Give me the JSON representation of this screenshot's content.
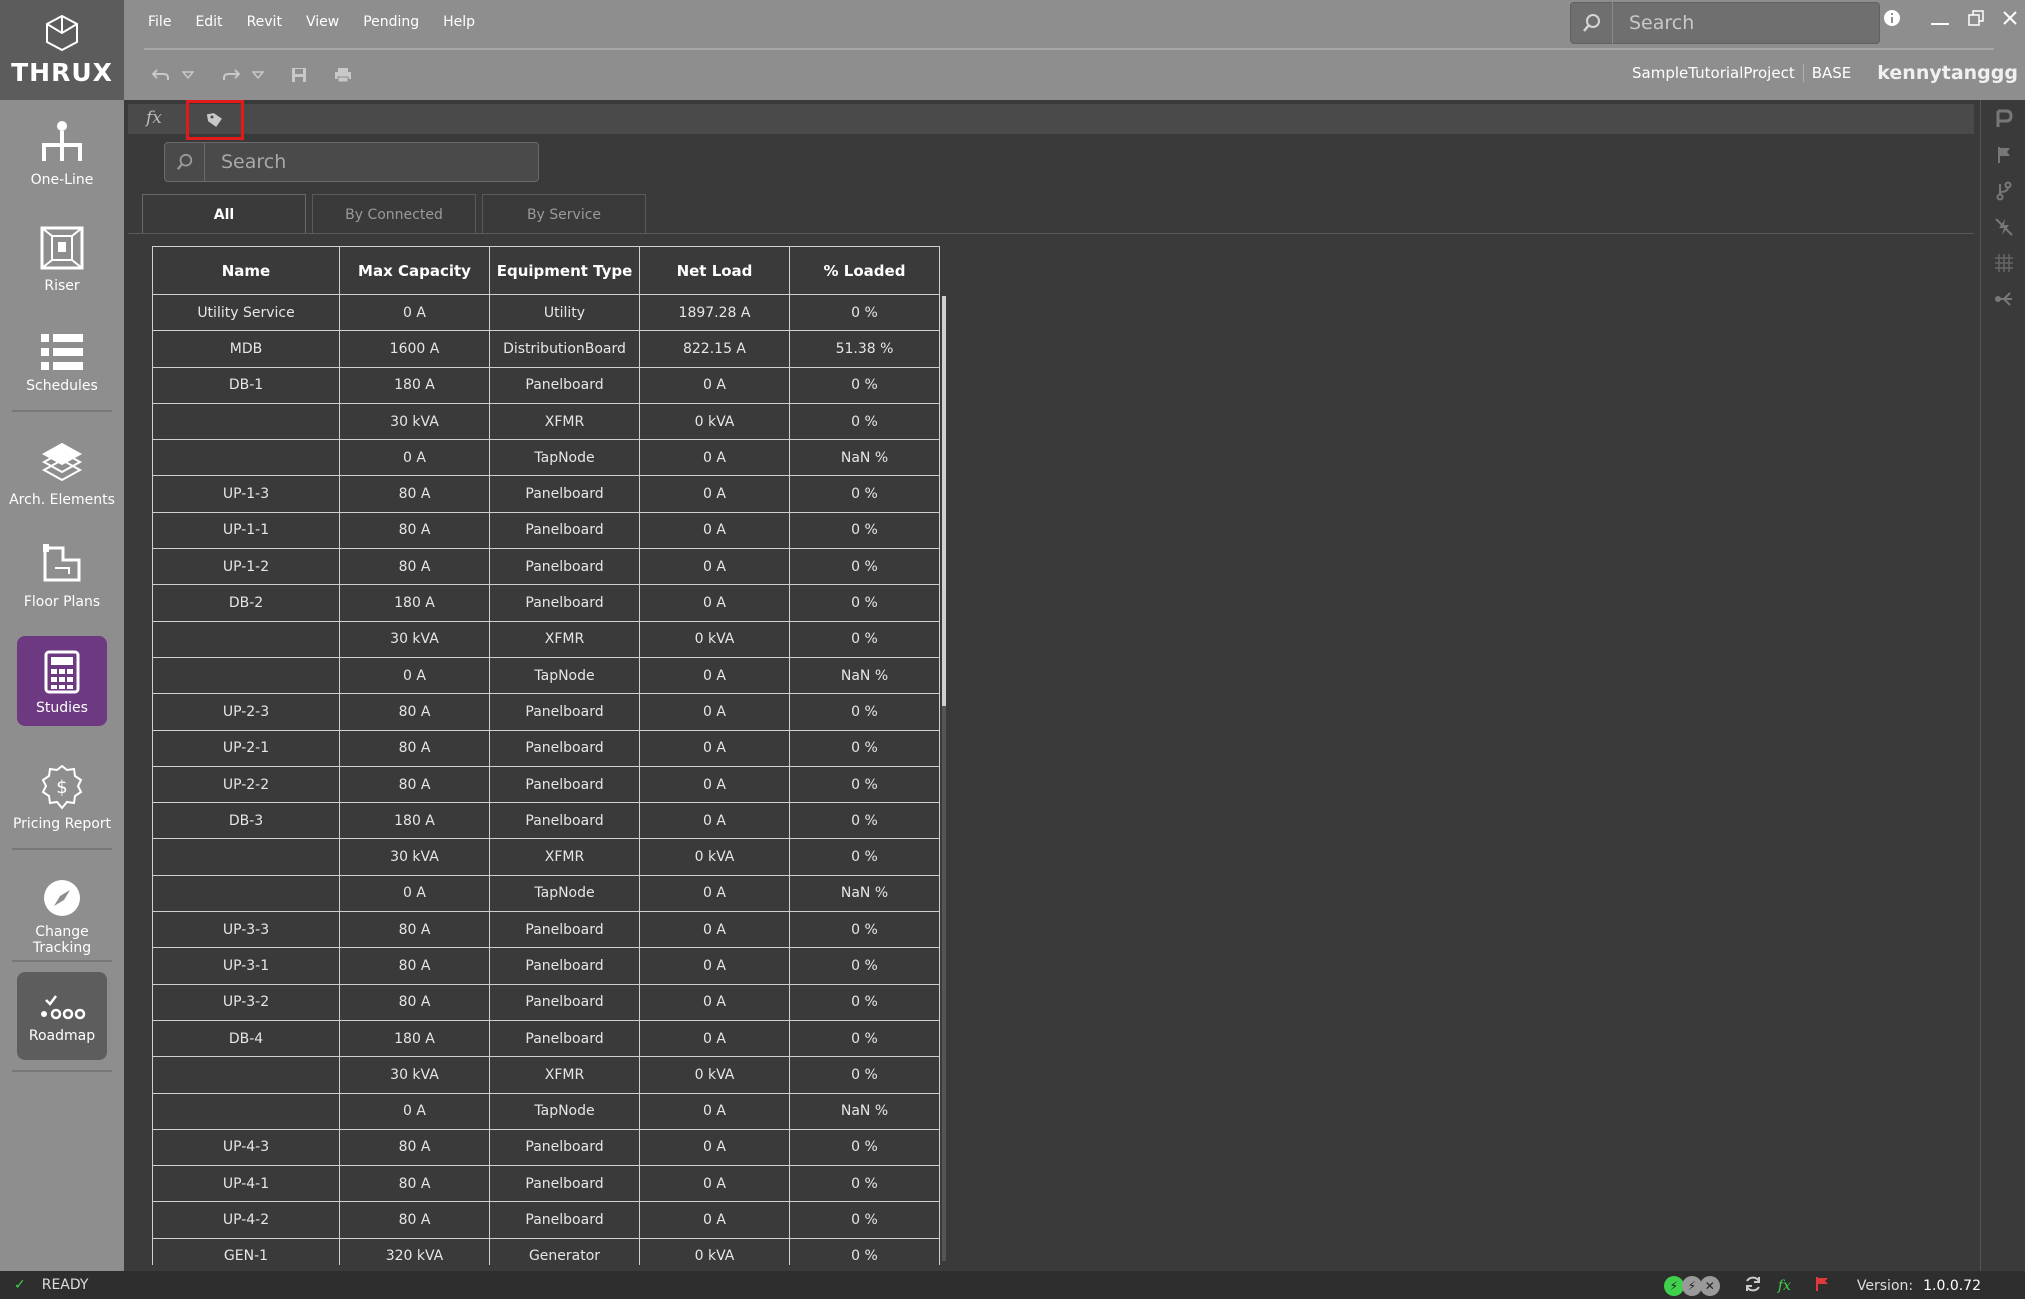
{
  "app": {
    "logo_text": "THRUX"
  },
  "menu": {
    "items": [
      "File",
      "Edit",
      "Revit",
      "View",
      "Pending",
      "Help"
    ]
  },
  "top_search": {
    "placeholder": "Search"
  },
  "project": {
    "name": "SampleTutorialProject",
    "branch": "BASE",
    "user": "kennytanggg"
  },
  "sidebar": {
    "items": [
      {
        "label": "One-Line",
        "icon": "one-line-icon"
      },
      {
        "label": "Riser",
        "icon": "riser-icon"
      },
      {
        "label": "Schedules",
        "icon": "schedules-icon"
      },
      {
        "label": "Arch. Elements",
        "icon": "arch-elements-icon"
      },
      {
        "label": "Floor Plans",
        "icon": "floor-plans-icon"
      },
      {
        "label": "Studies",
        "icon": "calculator-icon",
        "active": true
      },
      {
        "label": "Pricing Report",
        "icon": "pricing-report-icon"
      },
      {
        "label": "Change Tracking",
        "icon": "compass-icon"
      },
      {
        "label": "Roadmap",
        "icon": "roadmap-icon"
      }
    ]
  },
  "formula_bar": {
    "fx": "fx"
  },
  "table_search": {
    "placeholder": "Search"
  },
  "tabs": [
    {
      "label": "All",
      "active": true
    },
    {
      "label": "By Connected",
      "active": false
    },
    {
      "label": "By Service",
      "active": false
    }
  ],
  "table": {
    "columns": [
      "Name",
      "Max Capacity",
      "Equipment Type",
      "Net Load",
      "% Loaded"
    ],
    "rows": [
      [
        "Utility Service",
        "0 A",
        "Utility",
        "1897.28 A",
        "0 %"
      ],
      [
        "MDB",
        "1600 A",
        "DistributionBoard",
        "822.15 A",
        "51.38 %"
      ],
      [
        "DB-1",
        "180 A",
        "Panelboard",
        "0 A",
        "0 %"
      ],
      [
        "",
        "30 kVA",
        "XFMR",
        "0 kVA",
        "0 %"
      ],
      [
        "",
        "0 A",
        "TapNode",
        "0 A",
        "NaN %"
      ],
      [
        "UP-1-3",
        "80 A",
        "Panelboard",
        "0 A",
        "0 %"
      ],
      [
        "UP-1-1",
        "80 A",
        "Panelboard",
        "0 A",
        "0 %"
      ],
      [
        "UP-1-2",
        "80 A",
        "Panelboard",
        "0 A",
        "0 %"
      ],
      [
        "DB-2",
        "180 A",
        "Panelboard",
        "0 A",
        "0 %"
      ],
      [
        "",
        "30 kVA",
        "XFMR",
        "0 kVA",
        "0 %"
      ],
      [
        "",
        "0 A",
        "TapNode",
        "0 A",
        "NaN %"
      ],
      [
        "UP-2-3",
        "80 A",
        "Panelboard",
        "0 A",
        "0 %"
      ],
      [
        "UP-2-1",
        "80 A",
        "Panelboard",
        "0 A",
        "0 %"
      ],
      [
        "UP-2-2",
        "80 A",
        "Panelboard",
        "0 A",
        "0 %"
      ],
      [
        "DB-3",
        "180 A",
        "Panelboard",
        "0 A",
        "0 %"
      ],
      [
        "",
        "30 kVA",
        "XFMR",
        "0 kVA",
        "0 %"
      ],
      [
        "",
        "0 A",
        "TapNode",
        "0 A",
        "NaN %"
      ],
      [
        "UP-3-3",
        "80 A",
        "Panelboard",
        "0 A",
        "0 %"
      ],
      [
        "UP-3-1",
        "80 A",
        "Panelboard",
        "0 A",
        "0 %"
      ],
      [
        "UP-3-2",
        "80 A",
        "Panelboard",
        "0 A",
        "0 %"
      ],
      [
        "DB-4",
        "180 A",
        "Panelboard",
        "0 A",
        "0 %"
      ],
      [
        "",
        "30 kVA",
        "XFMR",
        "0 kVA",
        "0 %"
      ],
      [
        "",
        "0 A",
        "TapNode",
        "0 A",
        "NaN %"
      ],
      [
        "UP-4-3",
        "80 A",
        "Panelboard",
        "0 A",
        "0 %"
      ],
      [
        "UP-4-1",
        "80 A",
        "Panelboard",
        "0 A",
        "0 %"
      ],
      [
        "UP-4-2",
        "80 A",
        "Panelboard",
        "0 A",
        "0 %"
      ],
      [
        "GEN-1",
        "320 kVA",
        "Generator",
        "0 kVA",
        "0 %"
      ]
    ]
  },
  "status": {
    "text": "READY",
    "version_label": "Version:",
    "version": "1.0.0.72"
  },
  "colors": {
    "accent": "#6d3a82",
    "highlight": "#e21a1a",
    "avatar": "#e8743b",
    "ok": "#3fd14b"
  }
}
